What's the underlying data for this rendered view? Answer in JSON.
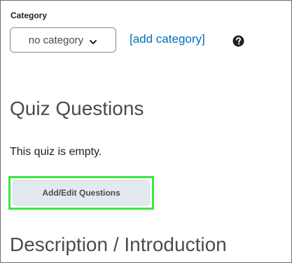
{
  "category": {
    "label": "Category",
    "selected_value": "no category",
    "add_link": "[add category]"
  },
  "quiz_questions": {
    "heading": "Quiz Questions",
    "empty_message": "This quiz is empty.",
    "edit_button": "Add/Edit Questions"
  },
  "description": {
    "heading": "Description / Introduction"
  },
  "icons": {
    "dropdown": "chevron-down-icon",
    "help": "help-icon"
  },
  "colors": {
    "link": "#006fbf",
    "highlight_border": "#3ce83c",
    "button_background": "#e3e9f1"
  }
}
